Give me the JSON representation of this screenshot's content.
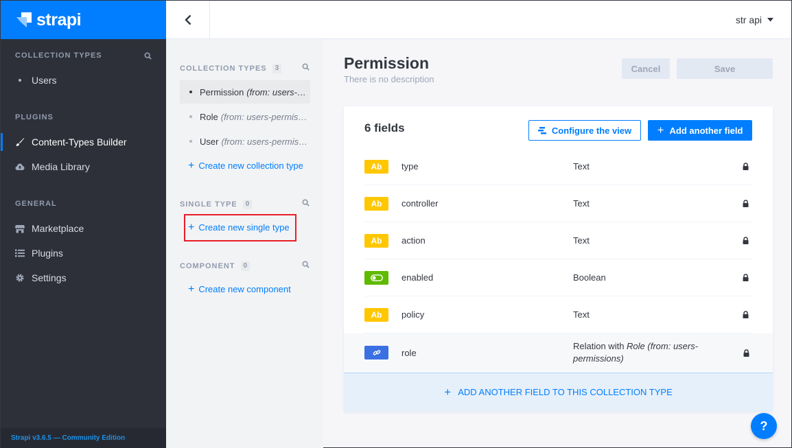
{
  "brand": {
    "name": "strapi"
  },
  "leftnav": {
    "collection_types_title": "COLLECTION TYPES",
    "collection_items": [
      {
        "label": "Users"
      }
    ],
    "plugins_title": "PLUGINS",
    "plugins": [
      {
        "label": "Content-Types Builder",
        "icon": "paintbrush-icon",
        "active": true
      },
      {
        "label": "Media Library",
        "icon": "cloud-upload-icon"
      }
    ],
    "general_title": "GENERAL",
    "general": [
      {
        "label": "Marketplace",
        "icon": "store-icon"
      },
      {
        "label": "Plugins",
        "icon": "list-icon"
      },
      {
        "label": "Settings",
        "icon": "gear-icon"
      }
    ],
    "footer": "Strapi v3.6.5 — Community Edition"
  },
  "header": {
    "user": "str api"
  },
  "ctb": {
    "collection_title": "COLLECTION TYPES",
    "collection_count": "3",
    "collection_items": [
      {
        "name": "Permission",
        "source": "(from: users-permissions)",
        "active": true
      },
      {
        "name": "Role",
        "source": "(from: users-permissions)"
      },
      {
        "name": "User",
        "source": "(from: users-permissions)"
      }
    ],
    "create_collection": "Create new collection type",
    "single_title": "SINGLE TYPE",
    "single_count": "0",
    "create_single": "Create new single type",
    "component_title": "COMPONENT",
    "component_count": "0",
    "create_component": "Create new component"
  },
  "main": {
    "title": "Permission",
    "description": "There is no description",
    "cancel": "Cancel",
    "save": "Save",
    "fields_count": "6 fields",
    "configure_view": "Configure the view",
    "add_field": "Add another field",
    "fields": [
      {
        "icon_label": "Ab",
        "name": "type",
        "type": "Text"
      },
      {
        "icon_label": "Ab",
        "name": "controller",
        "type": "Text"
      },
      {
        "icon_label": "Ab",
        "name": "action",
        "type": "Text"
      },
      {
        "icon_label": "",
        "name": "enabled",
        "type": "Boolean"
      },
      {
        "icon_label": "Ab",
        "name": "policy",
        "type": "Text"
      },
      {
        "icon_label": "",
        "name": "role",
        "type_prefix": "Relation with ",
        "type_target": "Role (from: users-permissions)"
      }
    ],
    "add_to_collection": "ADD ANOTHER FIELD TO THIS COLLECTION TYPE"
  },
  "help": "?",
  "colors": {
    "primary": "#007eff",
    "nav_bg": "#2e3039",
    "text_field": "#ffc700",
    "bool_field": "#5fba00",
    "relation_field": "#3b70e2",
    "highlight": "#e81e25"
  }
}
